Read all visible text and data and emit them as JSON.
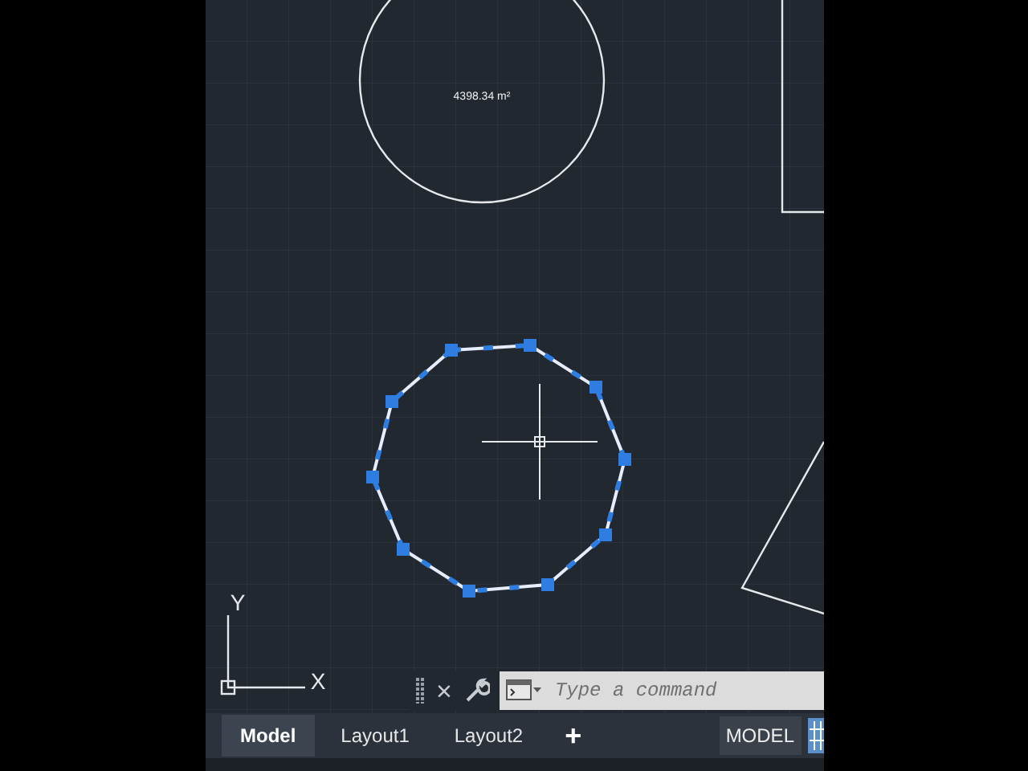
{
  "drawing": {
    "area_label": "4398.34 m²",
    "ucs": {
      "y_label": "Y",
      "x_label": "X"
    }
  },
  "command_line": {
    "close": "×",
    "placeholder": "Type a command"
  },
  "layout_tabs": [
    {
      "label": "Model",
      "selected": true
    },
    {
      "label": "Layout1",
      "selected": false
    },
    {
      "label": "Layout2",
      "selected": false
    }
  ],
  "add_tab": "+",
  "status_bar": {
    "space": "MODEL"
  }
}
